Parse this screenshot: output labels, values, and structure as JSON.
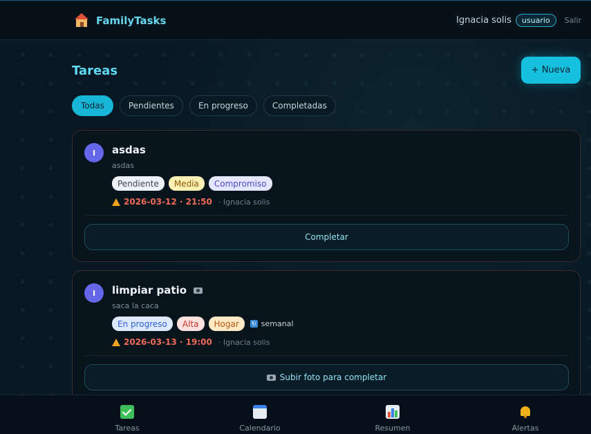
{
  "header": {
    "brand": "FamilyTasks",
    "brand_icon": "house-icon",
    "user_name": "Ignacia solis",
    "role": "usuario",
    "logout": "Salir"
  },
  "main": {
    "title": "Tareas",
    "new_button": "+ Nueva",
    "filters": [
      "Todas",
      "Pendientes",
      "En progreso",
      "Completadas"
    ],
    "active_filter": "Todas"
  },
  "tasks": [
    {
      "avatar": "I",
      "title": "asdas",
      "description": "asdas",
      "tags": [
        "Pendiente",
        "Media",
        "Compromiso"
      ],
      "due": "2026-03-12 · 21:50",
      "assignee": "· Ignacia solis",
      "action": "Completar"
    },
    {
      "avatar": "I",
      "title": "limpiar patio",
      "has_photo_icon": true,
      "description": "saca la caca",
      "tags": [
        "En progreso",
        "Alta",
        "Hogar"
      ],
      "recurrence": "semanal",
      "due": "2026-03-13 · 19:00",
      "assignee": "· Ignacia solis",
      "action": "Subir foto para completar"
    }
  ],
  "bottom_nav": [
    {
      "label": "Tareas",
      "icon": "check-icon"
    },
    {
      "label": "Calendario",
      "icon": "calendar-icon"
    },
    {
      "label": "Resumen",
      "icon": "chart-icon"
    },
    {
      "label": "Alertas",
      "icon": "bell-icon"
    }
  ],
  "colors": {
    "accent": "#16c1e0",
    "background": "#08131d",
    "due_date": "#f06a5a"
  }
}
